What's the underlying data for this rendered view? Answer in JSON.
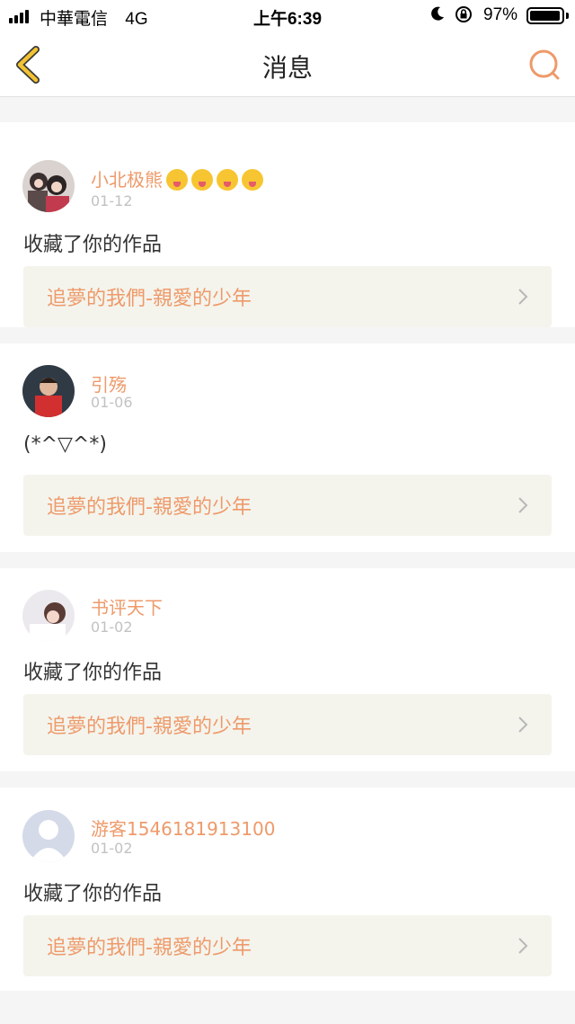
{
  "status_bar": {
    "carrier": "中華電信",
    "network": "4G",
    "time": "上午6:39",
    "battery": "97%",
    "battery_level": 0.97
  },
  "nav": {
    "title": "消息",
    "back_icon": "chevron-left-icon",
    "search_icon": "search-icon"
  },
  "colors": {
    "accent": "#ee9a6a",
    "back_arrow": "#f1c232",
    "link_bg": "#f4f4ed"
  },
  "messages": [
    {
      "username": "小北极熊",
      "emojis": [
        "squinting-tongue-emoji",
        "squinting-tongue-emoji",
        "zany-emoji",
        "zany-emoji"
      ],
      "date": "01-12",
      "text": "收藏了你的作品",
      "work_title": "追夢的我們-親愛的少年"
    },
    {
      "username": "引殇",
      "date": "01-06",
      "text": "(*^▽^*)",
      "work_title": "追夢的我們-親愛的少年"
    },
    {
      "username": "书评天下",
      "date": "01-02",
      "text": "收藏了你的作品",
      "work_title": "追夢的我們-親愛的少年"
    },
    {
      "username": "游客1546181913100",
      "date": "01-02",
      "text": "收藏了你的作品",
      "work_title": "追夢的我們-親愛的少年"
    }
  ]
}
